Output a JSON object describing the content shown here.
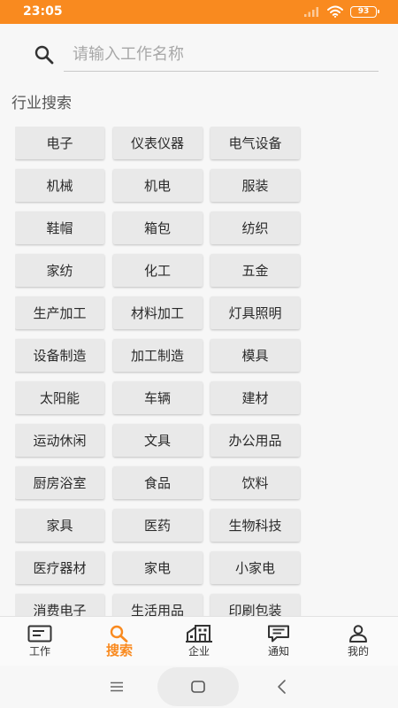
{
  "status_bar": {
    "time": "23:05",
    "battery": "93"
  },
  "search": {
    "placeholder": "请输入工作名称",
    "value": ""
  },
  "section_title": "行业搜索",
  "categories": [
    "电子",
    "仪表仪器",
    "电气设备",
    "机械",
    "机电",
    "服装",
    "鞋帽",
    "箱包",
    "纺织",
    "家纺",
    "化工",
    "五金",
    "生产加工",
    "材料加工",
    "灯具照明",
    "设备制造",
    "加工制造",
    "模具",
    "太阳能",
    "车辆",
    "建材",
    "运动休闲",
    "文具",
    "办公用品",
    "厨房浴室",
    "食品",
    "饮料",
    "家具",
    "医药",
    "生物科技",
    "医疗器材",
    "家电",
    "小家电",
    "消费电子",
    "生活用品",
    "印刷包装"
  ],
  "tabs": [
    {
      "label": "工作",
      "icon": "work-icon",
      "active": false
    },
    {
      "label": "搜索",
      "icon": "search-icon",
      "active": true
    },
    {
      "label": "企业",
      "icon": "company-icon",
      "active": false
    },
    {
      "label": "通知",
      "icon": "notification-icon",
      "active": false
    },
    {
      "label": "我的",
      "icon": "profile-icon",
      "active": false
    }
  ],
  "colors": {
    "accent": "#f98a1f",
    "tag_bg": "#e9e9e9",
    "text": "#2a2a2a"
  }
}
